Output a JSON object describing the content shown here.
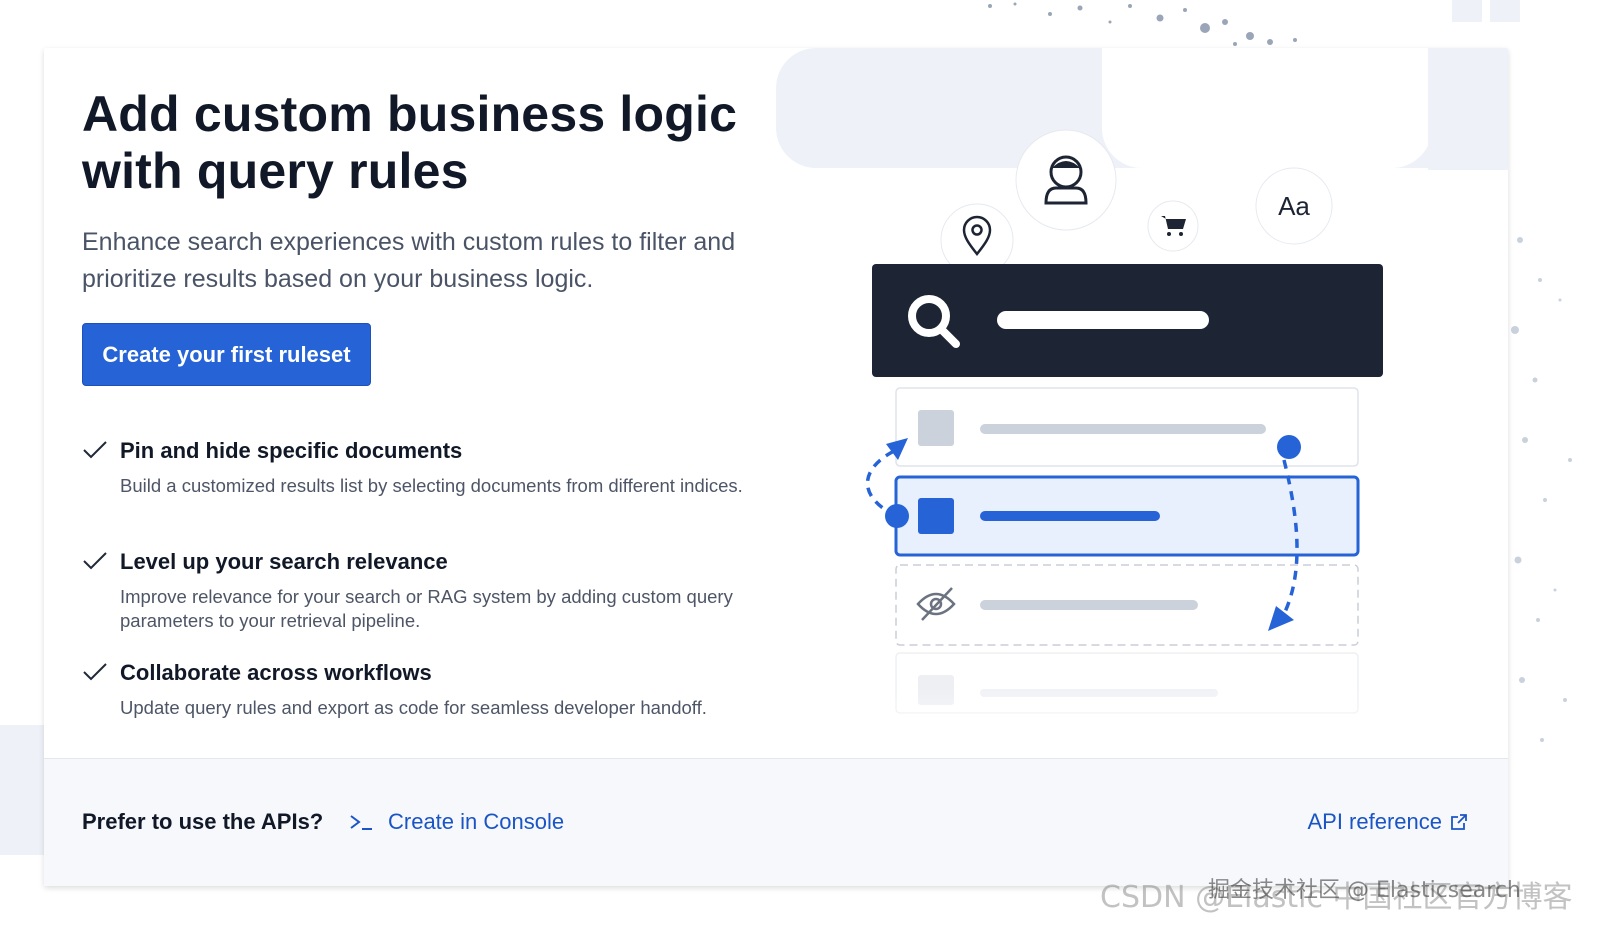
{
  "hero": {
    "title_line1": "Add custom business logic",
    "title_line2": "with query rules",
    "subtitle": "Enhance search experiences with custom rules to filter and prioritize results based on your business logic.",
    "cta_label": "Create your first ruleset"
  },
  "features": [
    {
      "title": "Pin and hide specific documents",
      "description": "Build a customized results list by selecting documents from different indices."
    },
    {
      "title": "Level up your search relevance",
      "description": "Improve relevance for your search or RAG system by adding custom query parameters to your retrieval pipeline."
    },
    {
      "title": "Collaborate across workflows",
      "description": "Update query rules and export as code for seamless developer handoff."
    }
  ],
  "footer": {
    "prefer_text": "Prefer to use the APIs?",
    "console_link": "Create in Console",
    "api_link": "API reference"
  },
  "illustration": {
    "font_icon_text": "Aa"
  },
  "watermark": {
    "line1": "CSDN @Elastic 中国社区官方博客",
    "line2": "掘金技术社区 @ Elasticsearch"
  },
  "colors": {
    "primary": "#2563d6",
    "link": "#1b55c5",
    "dark_search_bar": "#1d2433",
    "highlight_row": "#e8f0fd"
  },
  "icons": [
    "check-icon",
    "console-prompt-icon",
    "external-link-icon",
    "user-icon",
    "location-pin-icon",
    "cart-icon",
    "search-icon",
    "eye-slash-icon"
  ]
}
